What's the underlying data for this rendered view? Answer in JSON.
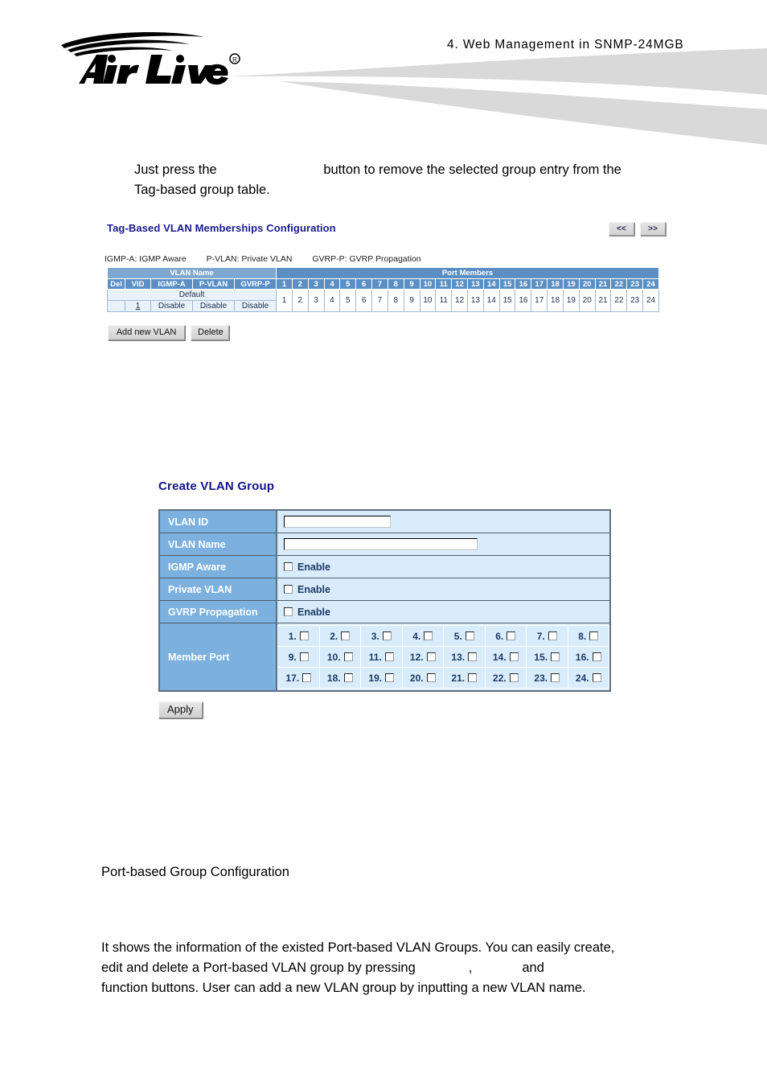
{
  "header": {
    "logo_text": "Air Live",
    "logo_mark": "registered-trademark",
    "section_title": "4.   Web  Management  in  SNMP-24MGB"
  },
  "intro_paragraph": {
    "before_button": "Just press the",
    "button_gap": "",
    "after_button": "button to remove the selected group entry from the",
    "line2": "Tag-based group table."
  },
  "tag_vlan": {
    "heading": "Tag-Based VLAN Memberships Configuration",
    "pager": {
      "prev_label": "<<",
      "next_label": ">>"
    },
    "legend": [
      "IGMP-A: IGMP Aware",
      "P-VLAN: Private VLAN",
      "GVRP-P: GVRP Propagation"
    ],
    "group_headers": {
      "vlan_name": "VLAN Name",
      "port_members": "Port Members"
    },
    "columns": [
      "Del",
      "VID",
      "IGMP-A",
      "P-VLAN",
      "GVRP-P"
    ],
    "port_header_numbers": [
      "1",
      "2",
      "3",
      "4",
      "5",
      "6",
      "7",
      "8",
      "9",
      "10",
      "11",
      "12",
      "13",
      "14",
      "15",
      "16",
      "17",
      "18",
      "19",
      "20",
      "21",
      "22",
      "23",
      "24"
    ],
    "rows": [
      {
        "name": "Default",
        "del": "",
        "vid": "1",
        "igmp_a": "Disable",
        "p_vlan": "Disable",
        "gvrp_p": "Disable",
        "ports": [
          "1",
          "2",
          "3",
          "4",
          "5",
          "6",
          "7",
          "8",
          "9",
          "10",
          "11",
          "12",
          "13",
          "14",
          "15",
          "16",
          "17",
          "18",
          "19",
          "20",
          "21",
          "22",
          "23",
          "24"
        ]
      }
    ],
    "buttons": {
      "add": "Add new VLAN",
      "delete": "Delete"
    }
  },
  "create_vlan": {
    "heading": "Create VLAN Group",
    "fields": [
      {
        "label": "VLAN ID",
        "value": "",
        "type": "text"
      },
      {
        "label": "VLAN Name",
        "value": "",
        "type": "text"
      },
      {
        "label": "IGMP Aware",
        "checkbox_label": "Enable",
        "checked": false,
        "type": "checkbox"
      },
      {
        "label": "Private VLAN",
        "checkbox_label": "Enable",
        "checked": false,
        "type": "checkbox"
      },
      {
        "label": "GVRP Propagation",
        "checkbox_label": "Enable",
        "checked": false,
        "type": "checkbox"
      }
    ],
    "member_port": {
      "label": "Member Port",
      "ports": [
        "1.",
        "2.",
        "3.",
        "4.",
        "5.",
        "6.",
        "7.",
        "8.",
        "9.",
        "10.",
        "11.",
        "12.",
        "13.",
        "14.",
        "15.",
        "16.",
        "17.",
        "18.",
        "19.",
        "20.",
        "21.",
        "22.",
        "23.",
        "24."
      ]
    },
    "apply_label": "Apply"
  },
  "port_based": {
    "heading": "Port-based Group Configuration",
    "paragraph": {
      "line1": "It shows the information of the existed Port-based VLAN Groups. You can easily create,",
      "line2_a": "edit  and  delete  a  Port-based  VLAN  group  by  pressing",
      "line2_comma": ",",
      "line2_and": "and",
      "line3": "function buttons. User can add a new VLAN group by inputting a new VLAN name."
    }
  },
  "colors": {
    "heading_blue": "#14148c",
    "table_header_blue": "#5b8fc4",
    "label_cell_blue": "#7cb0de",
    "value_cell_blue": "#d9ecfb",
    "swoosh_gray": "#d9d9d9"
  }
}
